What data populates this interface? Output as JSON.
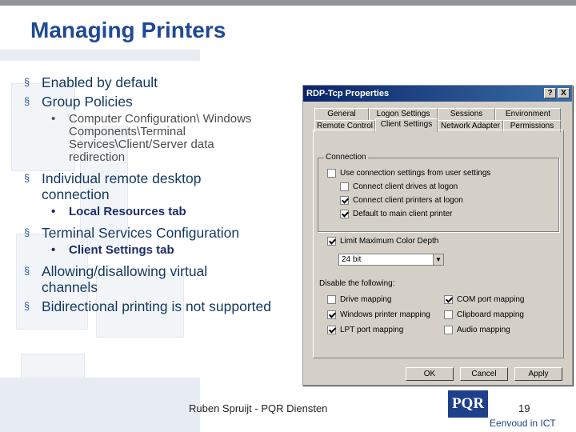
{
  "slide": {
    "title": "Managing Printers",
    "bullets": [
      {
        "level": 1,
        "text": "Enabled by default"
      },
      {
        "level": 1,
        "text": "Group Policies"
      },
      {
        "level": 2,
        "text": "Computer Configuration\\ Windows Components\\Terminal Services\\Client/Server data redirection"
      },
      {
        "level": 1,
        "text": "Individual remote desktop connection"
      },
      {
        "level": 2,
        "text": "Local Resources tab"
      },
      {
        "level": 1,
        "text": "Terminal Services Configuration"
      },
      {
        "level": 2,
        "text": "Client Settings tab"
      },
      {
        "level": 1,
        "text": "Allowing/disallowing virtual channels"
      },
      {
        "level": 1,
        "text": "Bidirectional printing is not supported"
      }
    ],
    "bullet_marker": "§",
    "sub_marker": "•"
  },
  "dialog": {
    "title": "RDP-Tcp Properties",
    "help_btn": "?",
    "close_btn": "X",
    "tabs_back": [
      "General",
      "Logon Settings",
      "Sessions",
      "Environment"
    ],
    "tabs_front": [
      "Remote Control",
      "Client Settings",
      "Network Adapter",
      "Permissions"
    ],
    "active_tab": "Client Settings",
    "connection_legend": "Connection",
    "use_user_settings": "Use connection settings from user settings",
    "connect_drives": "Connect client drives at logon",
    "connect_printers": "Connect client printers at logon",
    "default_printer": "Default to main client printer",
    "limit_color": "Limit Maximum Color Depth",
    "color_value": "24 bit",
    "disable_label": "Disable the following:",
    "drive_mapping": "Drive mapping",
    "windows_printer": "Windows printer mapping",
    "lpt_mapping": "LPT port mapping",
    "com_mapping": "COM port mapping",
    "clipboard_mapping": "Clipboard mapping",
    "audio_mapping": "Audio mapping",
    "ok": "OK",
    "cancel": "Cancel",
    "apply": "Apply"
  },
  "footer": {
    "author": "Ruben Spruijt - PQR Diensten",
    "page": "19",
    "logo": "PQR",
    "tagline": "Eenvoud in ICT"
  },
  "colors": {
    "title": "#1f4a92",
    "titlebar": "#0a246a",
    "dialog_bg": "#d4d0c8"
  }
}
